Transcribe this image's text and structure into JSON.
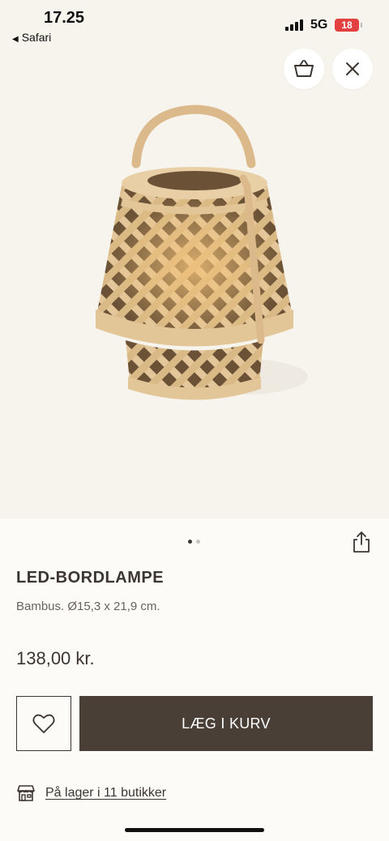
{
  "status_bar": {
    "time": "17.25",
    "back_app": "Safari",
    "network": "5G",
    "battery": "18"
  },
  "header": {
    "basket_icon": "basket-icon",
    "close_icon": "close-icon"
  },
  "gallery": {
    "image_alt": "LED-BORDLAMPE",
    "page_count": 2,
    "active_page": 1,
    "dot_active_color": "#3d3530",
    "dot_inactive_color": "#c9c4bf",
    "share_icon": "share-icon"
  },
  "product": {
    "title": "LED-BORDLAMPE",
    "description": "Bambus. Ø15,3 x 21,9 cm.",
    "price": "138,00 kr."
  },
  "actions": {
    "favorite_icon": "heart-icon",
    "add_to_cart_label": "LÆG I KURV",
    "cart_color": "#4a3f37"
  },
  "stock": {
    "store_icon": "store-icon",
    "label": "På lager i 11 butikker"
  }
}
